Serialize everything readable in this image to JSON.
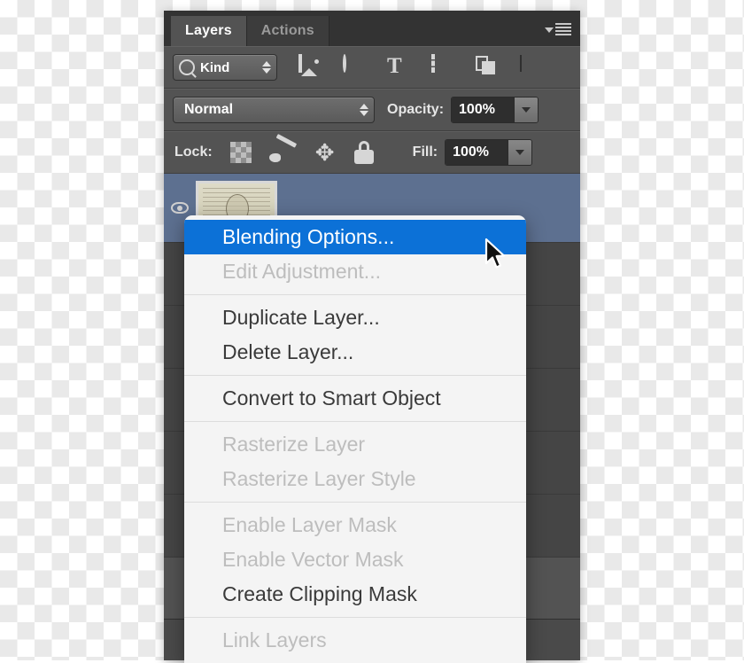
{
  "panel": {
    "tabs": [
      {
        "label": "Layers",
        "active": true
      },
      {
        "label": "Actions",
        "active": false
      }
    ],
    "menu_button_name": "panel-menu-icon",
    "filter_row": {
      "kind_label": "Kind",
      "icons": [
        "pixel-layer-filter-icon",
        "adjustment-layer-filter-icon",
        "type-layer-filter-icon",
        "shape-layer-filter-icon",
        "smart-object-filter-icon",
        "filter-toggle-icon"
      ]
    },
    "blend_row": {
      "blend_mode": "Normal",
      "opacity_label": "Opacity:",
      "opacity_value": "100%"
    },
    "lock_row": {
      "lock_label": "Lock:",
      "lock_icons": [
        "lock-transparent-pixels-icon",
        "lock-image-pixels-icon",
        "lock-position-icon",
        "lock-all-icon"
      ],
      "fill_label": "Fill:",
      "fill_value": "100%"
    }
  },
  "context_menu": {
    "groups": [
      {
        "items": [
          {
            "label": "Blending Options...",
            "state": "highlighted"
          },
          {
            "label": "Edit Adjustment...",
            "state": "disabled"
          }
        ]
      },
      {
        "items": [
          {
            "label": "Duplicate Layer...",
            "state": "enabled"
          },
          {
            "label": "Delete Layer...",
            "state": "enabled"
          }
        ]
      },
      {
        "items": [
          {
            "label": "Convert to Smart Object",
            "state": "enabled"
          }
        ]
      },
      {
        "items": [
          {
            "label": "Rasterize Layer",
            "state": "disabled"
          },
          {
            "label": "Rasterize Layer Style",
            "state": "disabled"
          }
        ]
      },
      {
        "items": [
          {
            "label": "Enable Layer Mask",
            "state": "disabled"
          },
          {
            "label": "Enable Vector Mask",
            "state": "disabled"
          },
          {
            "label": "Create Clipping Mask",
            "state": "enabled"
          }
        ]
      },
      {
        "items": [
          {
            "label": "Link Layers",
            "state": "disabled"
          }
        ]
      }
    ]
  },
  "colors": {
    "highlight": "#0c71d7",
    "panel_bg": "#535353",
    "tabstrip_bg": "#333333",
    "layer_selected": "#5d7090",
    "menu_bg": "#f4f4f4",
    "disabled_text": "#bdbdbd",
    "enabled_text": "#3a3a3a"
  },
  "cursor": {
    "name": "mouse-pointer-arrow"
  }
}
